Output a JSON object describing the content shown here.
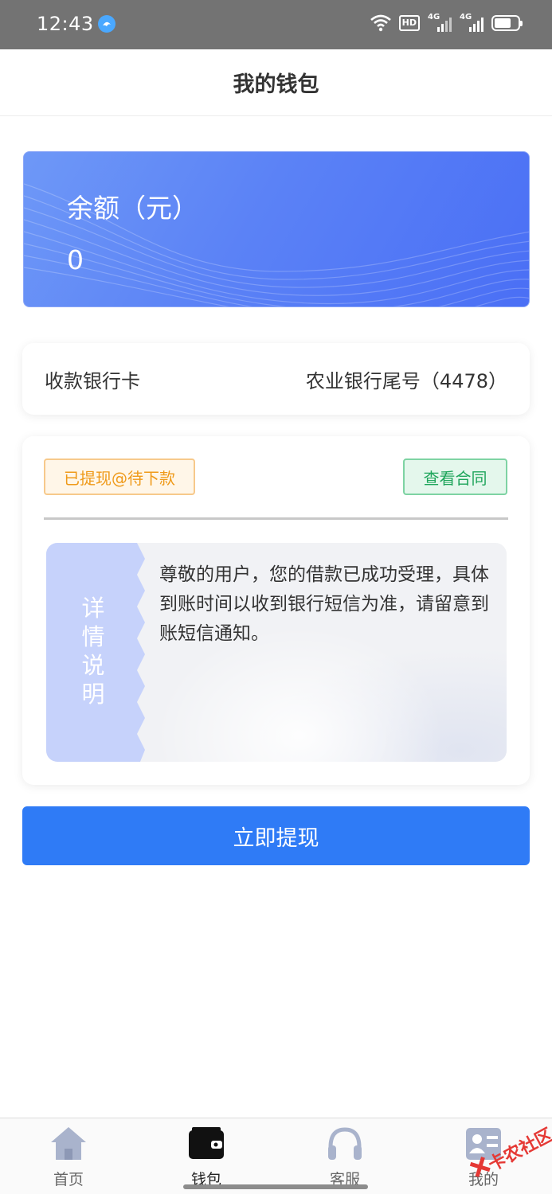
{
  "status_bar": {
    "time": "12:43",
    "network_badge": "HD",
    "signal_1": "4G",
    "signal_2": "4G",
    "icons": [
      "app-icon",
      "wifi-icon",
      "hd-icon",
      "signal-icon",
      "signal-icon",
      "battery-icon"
    ]
  },
  "header": {
    "title": "我的钱包"
  },
  "balance": {
    "label": "余额（元）",
    "value": "0"
  },
  "bank_card": {
    "label": "收款银行卡",
    "value": "农业银行尾号（4478）"
  },
  "status": {
    "tag": "已提现@待下款",
    "contract_button": "查看合同",
    "detail_label": "详情说明",
    "detail_text": "尊敬的用户，您的借款已成功受理，具体到账时间以收到银行短信为准，请留意到账短信通知。"
  },
  "withdraw_button": "立即提现",
  "tabs": [
    {
      "label": "首页",
      "icon": "home-icon",
      "active": false
    },
    {
      "label": "钱包",
      "icon": "wallet-icon",
      "active": true
    },
    {
      "label": "客服",
      "icon": "headset-icon",
      "active": false
    },
    {
      "label": "我的",
      "icon": "profile-card-icon",
      "active": false
    }
  ],
  "watermark": {
    "text": "卡农社区"
  },
  "colors": {
    "primary": "#2f7bf6",
    "balance_card": "#5b82f6",
    "tag_orange": "#ef9a1a",
    "tag_green": "#1fa55b",
    "detail_side": "#c6d2fb"
  }
}
